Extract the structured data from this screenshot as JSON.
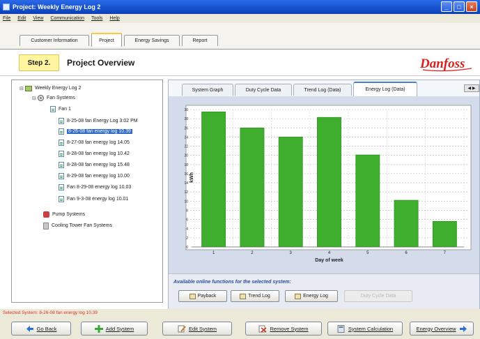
{
  "window": {
    "title": "Project: Weekly Energy Log 2"
  },
  "menu": [
    "File",
    "Edit",
    "View",
    "Communication",
    "Tools",
    "Help"
  ],
  "main_tabs": [
    {
      "label": "Customer Information",
      "active": false
    },
    {
      "label": "Project",
      "active": true
    },
    {
      "label": "Energy Savings",
      "active": false
    },
    {
      "label": "Report",
      "active": false
    }
  ],
  "step": {
    "badge": "Step 2.",
    "title": "Project Overview",
    "logo_text": "Danfoss"
  },
  "tree": {
    "root": "Weekly Energy Log 2",
    "fan_systems": "Fan Systems",
    "fan1": "Fan 1",
    "logs": [
      "8-25-08 fan Energy Log 3:02 PM",
      "8-26-08 fan energy log 10.39",
      "8-27-08 fan energy log 14.05",
      "8-28-08 fan energy log 10.42",
      "8-28-08 fan energy log 15.48",
      "8-29-08 fan energy log 10.00",
      "Fan 8-29-08 energy log 10.03",
      "Fan 9-3-08 energy log 10.01"
    ],
    "selected_index": 1,
    "pump_systems": "Pump Systems",
    "cooling_tower": "Cooling Tower Fan Systems"
  },
  "sub_tabs": [
    {
      "label": "System Graph",
      "active": false
    },
    {
      "label": "Duty Cycle Data",
      "active": false
    },
    {
      "label": "Trend Log (Data)",
      "active": false
    },
    {
      "label": "Energy Log (Data)",
      "active": true
    }
  ],
  "chart_data": {
    "type": "bar",
    "categories": [
      "1",
      "2",
      "3",
      "4",
      "5",
      "6",
      "7"
    ],
    "values": [
      29.5,
      26,
      24,
      28.3,
      20.1,
      10.2,
      5.6
    ],
    "xlabel": "Day of week",
    "ylabel": "kWh",
    "ylim": [
      0,
      30
    ],
    "yticks": [
      0,
      2,
      4,
      6,
      8,
      10,
      12,
      14,
      16,
      18,
      20,
      22,
      24,
      26,
      28,
      30
    ],
    "grid": true,
    "bar_color": "#3fad2e"
  },
  "functions": {
    "title": "Available online functions for the selected system:",
    "buttons": [
      {
        "label": "Payback",
        "enabled": true
      },
      {
        "label": "Trend Log",
        "enabled": true
      },
      {
        "label": "Energy Log",
        "enabled": true
      },
      {
        "label": "Duty Cycle Data",
        "enabled": false
      }
    ]
  },
  "status": "Selected System: 8-26-08 fan energy log 10.39",
  "bottom_buttons": [
    {
      "label": "Go Back",
      "icon": "back-arrow-icon"
    },
    {
      "label": "Add System",
      "icon": "add-icon"
    },
    {
      "label": "Edit System",
      "icon": "edit-icon"
    },
    {
      "label": "Remove System",
      "icon": "remove-icon"
    },
    {
      "label": "System Calculation",
      "icon": "calculator-icon"
    },
    {
      "label": "Energy Overview",
      "icon": "forward-arrow-icon"
    }
  ]
}
